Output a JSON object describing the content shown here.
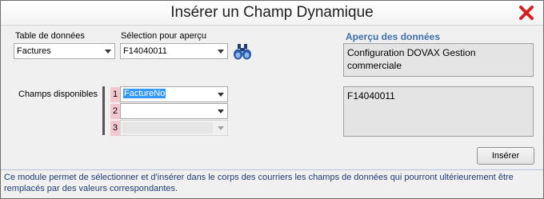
{
  "window": {
    "title": "Insérer un Champ Dynamique",
    "close_icon": "close-x-icon"
  },
  "table_label": "Table de données",
  "table_select": {
    "value": "Factures"
  },
  "preview_label": "Sélection pour aperçu",
  "preview_select": {
    "value": "F14040011"
  },
  "binoculars_icon": "binoculars-icon",
  "fields_label": "Champs disponibles",
  "fields": [
    {
      "num": "1",
      "value": "FactureNo",
      "state": "selected"
    },
    {
      "num": "2",
      "value": "",
      "state": "enabled"
    },
    {
      "num": "3",
      "value": "",
      "state": "disabled"
    }
  ],
  "data_preview": {
    "heading": "Aperçu des données",
    "line1": "Configuration DOVAX Gestion commerciale",
    "line2": "F14040011"
  },
  "insert_button": "Insérer",
  "footer_text": "Ce module permet de sélectionner et d'insérer dans le corps des courriers les champs de données qui pourront ultérieurement être remplacés par des valeurs correspondantes.",
  "colors": {
    "accent": "#3d6fb0",
    "footer_text": "#1e3d73",
    "field_number_bg": "#f3c9cf",
    "selection": "#3399ff",
    "close_icon": "#d42020"
  }
}
